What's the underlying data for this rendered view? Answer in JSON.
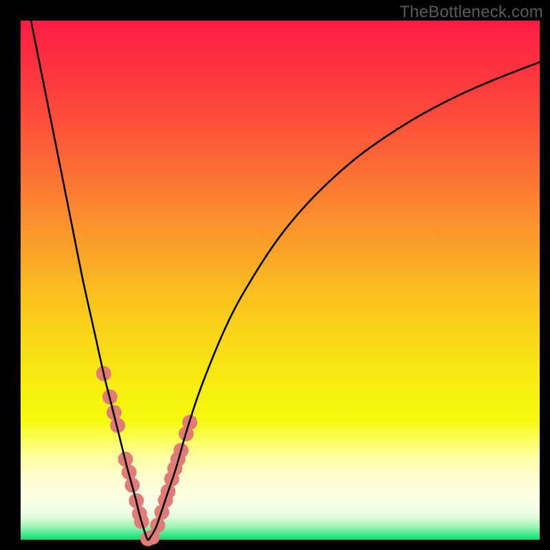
{
  "watermark": "TheBottleneck.com",
  "colors": {
    "frame": "#000000",
    "curve": "#000000",
    "dot_fill": "#e17b78",
    "gradient_stops": [
      {
        "offset": 0.0,
        "color": "#fd1d43"
      },
      {
        "offset": 0.18,
        "color": "#fd4a3c"
      },
      {
        "offset": 0.38,
        "color": "#fb8e2e"
      },
      {
        "offset": 0.55,
        "color": "#fac71d"
      },
      {
        "offset": 0.7,
        "color": "#f7ee10"
      },
      {
        "offset": 0.77,
        "color": "#f6f90f"
      },
      {
        "offset": 0.81,
        "color": "#fbfe62"
      },
      {
        "offset": 0.84,
        "color": "#fffea2"
      },
      {
        "offset": 0.88,
        "color": "#fffecf"
      },
      {
        "offset": 0.92,
        "color": "#fdffe6"
      },
      {
        "offset": 0.955,
        "color": "#e7fce1"
      },
      {
        "offset": 0.975,
        "color": "#a1f4b5"
      },
      {
        "offset": 0.99,
        "color": "#3fe988"
      },
      {
        "offset": 1.0,
        "color": "#05e36d"
      }
    ]
  },
  "chart_data": {
    "type": "line",
    "title": "",
    "xlabel": "",
    "ylabel": "",
    "xlim": [
      0,
      100
    ],
    "ylim": [
      0,
      100
    ],
    "note": "V-shaped bottleneck curve. Values are read off the plotted black curve (x in % of plot width, y in % of plot height, y=0 at bottom/green, y=100 at top/red). Minimum ≈0 at x≈24.5.",
    "series": [
      {
        "name": "bottleneck-curve",
        "x": [
          2.0,
          4.0,
          6.0,
          8.0,
          10.0,
          12.0,
          14.0,
          16.0,
          17.5,
          19.0,
          20.5,
          22.0,
          23.0,
          24.0,
          24.5,
          25.0,
          26.0,
          27.0,
          28.5,
          30.0,
          32.0,
          35.0,
          40.0,
          45.0,
          50.0,
          55.0,
          60.0,
          65.0,
          70.0,
          75.0,
          80.0,
          85.0,
          90.0,
          95.0,
          100.0
        ],
        "y": [
          100,
          90,
          80,
          70,
          60,
          50,
          41,
          32,
          26,
          20,
          14,
          8.5,
          4.5,
          1.2,
          0.0,
          0.5,
          2.2,
          5.0,
          9.5,
          14.0,
          21.0,
          30.0,
          42.0,
          51.0,
          58.5,
          64.5,
          69.5,
          73.8,
          77.4,
          80.6,
          83.4,
          85.9,
          88.1,
          90.1,
          92.0
        ]
      }
    ],
    "dots": {
      "name": "reference-points",
      "x": [
        16.0,
        17.2,
        18.0,
        18.7,
        20.2,
        20.9,
        21.5,
        22.3,
        22.9,
        23.3,
        24.5,
        25.4,
        26.4,
        27.2,
        27.9,
        28.4,
        29.1,
        29.7,
        30.3,
        30.9,
        31.9,
        32.6
      ],
      "y": [
        32.0,
        27.5,
        24.5,
        22.0,
        15.5,
        13.0,
        10.5,
        7.5,
        5.0,
        3.5,
        0.2,
        0.5,
        2.8,
        5.3,
        7.6,
        9.3,
        11.7,
        13.7,
        15.5,
        17.2,
        20.4,
        22.6
      ],
      "r_pct": 1.45
    }
  }
}
